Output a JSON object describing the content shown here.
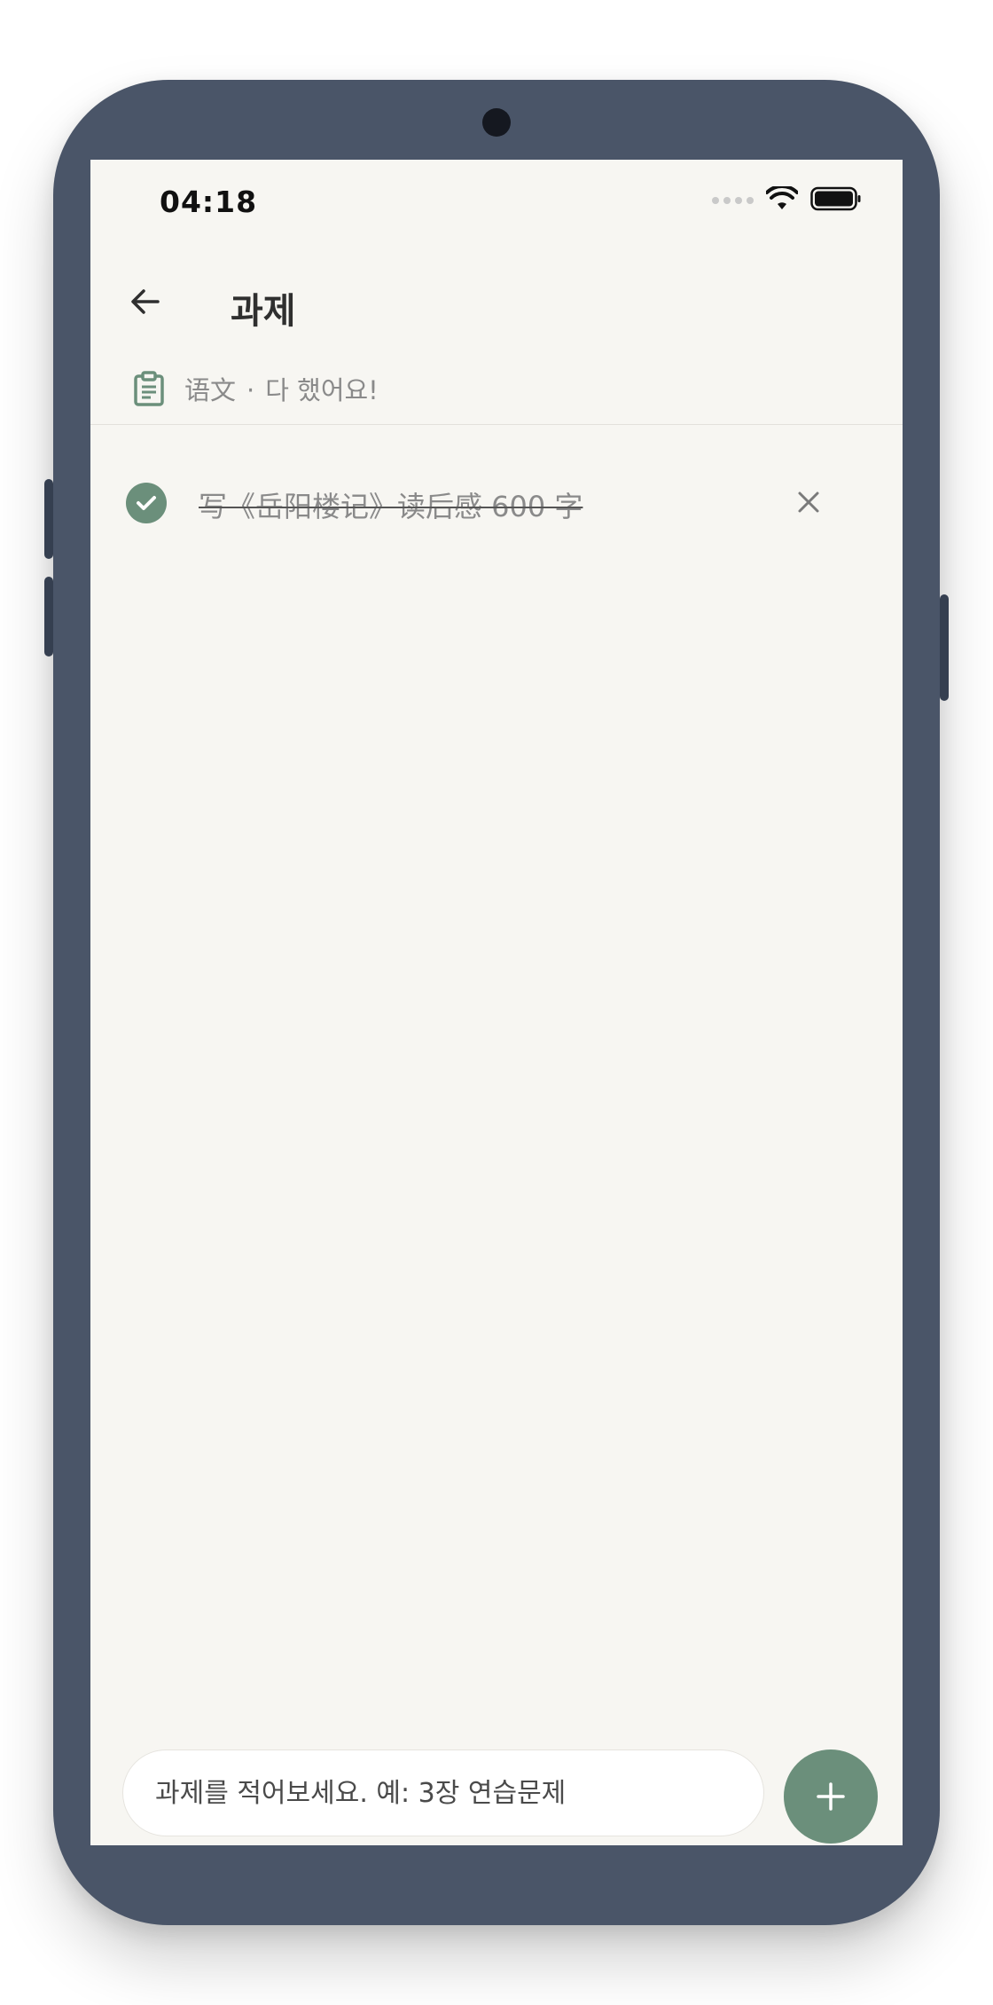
{
  "status_bar": {
    "time": "04:18",
    "icons": [
      "signal-dots-icon",
      "wifi-icon",
      "battery-icon"
    ]
  },
  "header": {
    "title": "과제",
    "back_icon": "arrow-left-icon"
  },
  "subject": {
    "icon": "clipboard-icon",
    "name": "语文",
    "separator": "·",
    "status": "다 했어요!"
  },
  "tasks": [
    {
      "text": "写《岳阳楼记》读后感 600 字",
      "done": true,
      "check_icon": "check-circle-icon",
      "delete_icon": "close-icon"
    }
  ],
  "composer": {
    "placeholder": "과제를 적어보세요. 예: 3장 연습문제",
    "value": "",
    "add_icon": "plus-icon"
  },
  "colors": {
    "accent": "#6b8f7b",
    "screen_background": "#f7f6f2",
    "device_frame": "#4a5568",
    "muted_text": "#8a8a8a"
  }
}
